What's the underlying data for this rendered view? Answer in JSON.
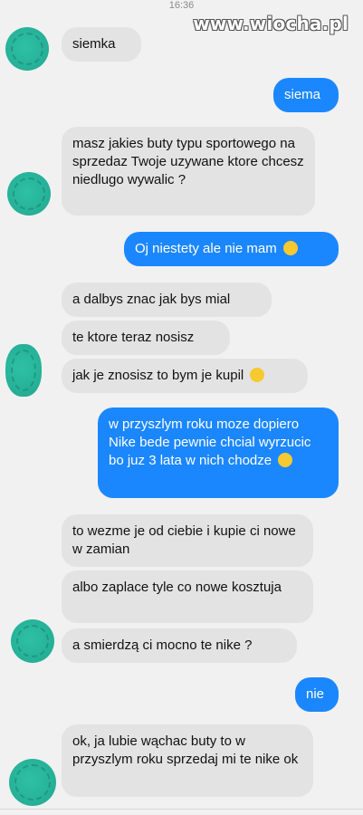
{
  "status": {
    "time": "16:36"
  },
  "watermark": "www.wiocha.pl",
  "messages": [
    {
      "text": "siemka"
    },
    {
      "text": "siema"
    },
    {
      "text": "masz jakies buty typu sportowego na sprzedaz Twoje uzywane ktore chcesz niedlugo wywalic ?"
    },
    {
      "text": "Oj niestety ale nie mam"
    },
    {
      "text": "a dalbys znac jak bys mial"
    },
    {
      "text": "te ktore teraz nosisz"
    },
    {
      "text": "jak je znosisz to bym je kupil"
    },
    {
      "text": "w przyszlym roku moze dopiero Nike bede pewnie chcial wyrzucic bo juz 3 lata w nich chodze"
    },
    {
      "text": "to wezme je od ciebie i kupie ci nowe w zamian"
    },
    {
      "text": "albo zaplace tyle co nowe kosztuja"
    },
    {
      "text": "a smierdzą ci mocno te nike ?"
    },
    {
      "text": "nie"
    },
    {
      "text": "ok, ja lubie wąchac buty to w przyszlym roku sprzedaj mi te nike ok"
    }
  ],
  "colors": {
    "incoming": "#e3e3e3",
    "outgoing": "#1b87ff",
    "background": "#f1f1f1"
  },
  "icons": {
    "smile_wink": "smile-wink-icon",
    "smile_tongue": "smile-tongue-icon"
  }
}
